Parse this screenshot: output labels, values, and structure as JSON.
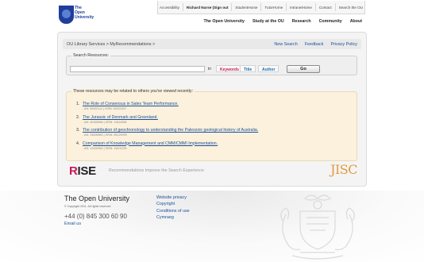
{
  "logo": {
    "line1": "The",
    "line2": "Open",
    "line3": "University"
  },
  "topbar": {
    "items": [
      "Accessibility",
      "Richard Nurse (Sign out",
      "StudentHome",
      "TutorHome",
      "IntranetHome",
      "Contact",
      "Search the OU"
    ]
  },
  "mainnav": [
    "The Open University",
    "Study at the OU",
    "Research",
    "Community",
    "About"
  ],
  "breadcrumb": {
    "part1": "OU Library Services",
    "sep": ">",
    "part2": "MyRecommendations",
    "sep2": ">"
  },
  "crumblinks": [
    "New Search",
    "Feedback",
    "Privacy Policy"
  ],
  "search": {
    "legend": "Search Resources:",
    "value": "",
    "in_label": "in",
    "options": [
      "Keywords",
      "Title",
      "Author"
    ],
    "go_label": "Go"
  },
  "recommendations": {
    "legend": "These resources may be related to others you've viewed recently:",
    "items": [
      {
        "num": "1.",
        "title": "The Role of Consensus in Sales Team Performance.",
        "meta": "- AN: 50522111 | ISSN: 00222437"
      },
      {
        "num": "2.",
        "title": "The Jurassic of Denmark and Greenland.",
        "meta": "- AN: 40165566 | ISSN: 11614958"
      },
      {
        "num": "3.",
        "title": "The contribution of geochronology to understanding the Paleozoic geological history of Australia.",
        "meta": "- AN: 33606860 | ISSN: 08120099"
      },
      {
        "num": "4.",
        "title": "Comparison of Knowledge Management and CMM/CMMI Implementation.",
        "meta": "- AN: 12439960 | ISSN: 15401200"
      }
    ]
  },
  "rise": {
    "r": "R",
    "rest": "ISE",
    "tagline": "Recommendations Improve the Search Experience"
  },
  "jisc": "JISC",
  "footer": {
    "title": "The Open University",
    "copyright": "© Copyright 2011. All rights reserved",
    "phone": "+44 (0) 845 300 60 90",
    "email": "Email us",
    "links": [
      "Website privacy",
      "Copyright",
      "Conditions of use",
      "Cymraeg"
    ]
  },
  "colors": {
    "accent": "#c8185b",
    "link": "#1a4f9c",
    "jisc": "#e39a3a",
    "recs_bg": "#fbf1dc"
  }
}
